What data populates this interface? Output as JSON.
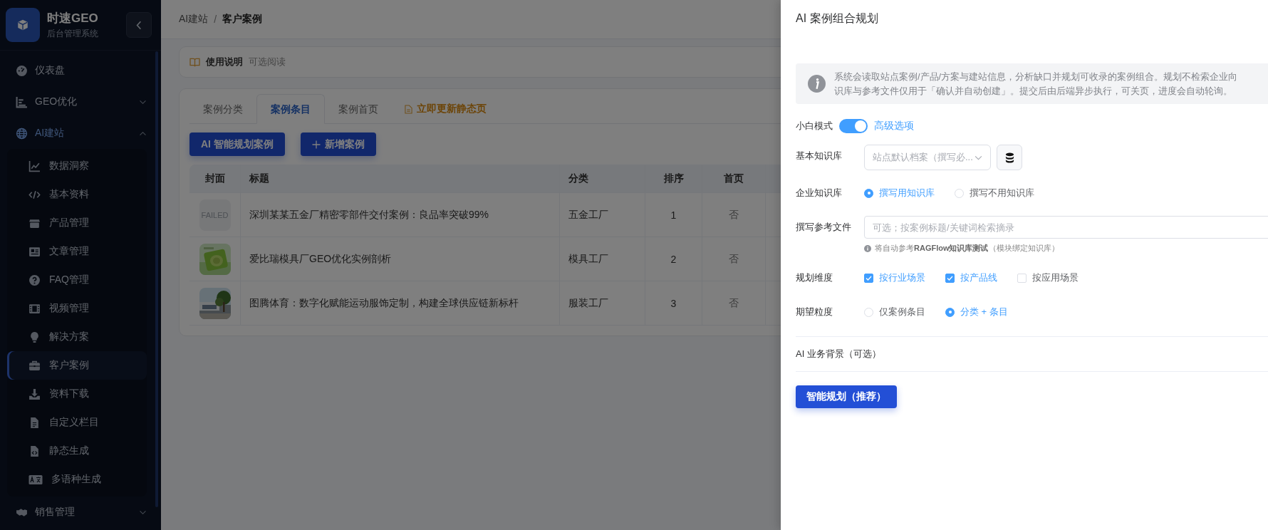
{
  "sidebar": {
    "brand": {
      "title": "时速GEO",
      "subtitle": "后台管理系统"
    },
    "items": [
      {
        "label": "仪表盘"
      },
      {
        "label": "GEO优化",
        "expanded": false
      },
      {
        "label": "AI建站",
        "expanded": true,
        "children": [
          {
            "label": "数据洞察",
            "selected": false
          },
          {
            "label": "基本资料",
            "selected": false
          },
          {
            "label": "产品管理",
            "selected": false
          },
          {
            "label": "文章管理",
            "selected": false
          },
          {
            "label": "FAQ管理",
            "selected": false
          },
          {
            "label": "视频管理",
            "selected": false
          },
          {
            "label": "解决方案",
            "selected": false
          },
          {
            "label": "客户案例",
            "selected": true
          },
          {
            "label": "资料下载",
            "selected": false
          },
          {
            "label": "自定义栏目",
            "selected": false
          },
          {
            "label": "静态生成",
            "selected": false
          },
          {
            "label": "多语种生成",
            "selected": false
          }
        ]
      },
      {
        "label": "销售管理",
        "expanded": false
      }
    ]
  },
  "breadcrumb": {
    "separator": "/",
    "items": [
      "AI建站",
      "客户案例"
    ]
  },
  "notice": {
    "title": "使用说明",
    "hint": "可选阅读"
  },
  "tabs": [
    {
      "label": "案例分类",
      "selected": false
    },
    {
      "label": "案例条目",
      "selected": true
    },
    {
      "label": "案例首页",
      "selected": false
    }
  ],
  "tab_action": "立即更新静态页",
  "buttons": [
    {
      "kind": "ai",
      "label": "AI 智能规划案例"
    },
    {
      "kind": "add",
      "label": "新增案例"
    }
  ],
  "table": {
    "columns": [
      "封面",
      "标题",
      "分类",
      "排序",
      "首页"
    ],
    "rows": [
      {
        "cover": {
          "kind": "failed",
          "text": "FAILED"
        },
        "title": "深圳某某五金厂精密零部件交付案例：良品率突破99%",
        "category": "五金工厂",
        "order": "1",
        "home": "否"
      },
      {
        "title": "爱比瑞模具厂GEO优化实例剖析",
        "category": "模具工厂",
        "order": "2",
        "home": "否"
      },
      {
        "title": "图腾体育：数字化赋能运动服饰定制，构建全球供应链新标杆",
        "category": "服装工厂",
        "order": "3",
        "home": "否"
      }
    ]
  },
  "drawer": {
    "title": "AI 案例组合规划",
    "info_lines": [
      "系统会读取站点案例/产品/方案与建站信息，分析缺口并规划可收录的案例组合。规划不检索企业向",
      "识库与参考文件仅用于「确认并自动创建」。提交后由后端异步执行，可关页，进度会自动轮询。"
    ],
    "mode": {
      "label": "小白模式",
      "on": true,
      "link": "高级选项"
    },
    "fields": [
      {
        "kind": "select",
        "label": "基本知识库",
        "placeholder": "站点默认档案（撰写必..."
      },
      {
        "kind": "radio",
        "label": "企业知识库",
        "options": [
          {
            "label": "撰写用知识库",
            "selected": true
          },
          {
            "label": "撰写不用知识库",
            "selected": false
          }
        ]
      },
      {
        "kind": "input",
        "label": "撰写参考文件",
        "placeholder": "可选；按案例标题/关键词检索摘录",
        "hint": "将自动参考**RAGFlow知识库测试**（模块绑定知识库）"
      },
      {
        "kind": "checkbox",
        "label": "规划维度",
        "options": [
          {
            "label": "按行业场景",
            "checked": true
          },
          {
            "label": "按产品线",
            "checked": true
          },
          {
            "label": "按应用场景",
            "checked": false
          }
        ]
      },
      {
        "kind": "radio",
        "label": "期望粒度",
        "options": [
          {
            "label": "仅案例条目",
            "selected": false
          },
          {
            "label": "分类 + 条目",
            "selected": true
          }
        ]
      }
    ],
    "section": "AI 业务背景（可选）",
    "submit": "智能规划（推荐）"
  }
}
